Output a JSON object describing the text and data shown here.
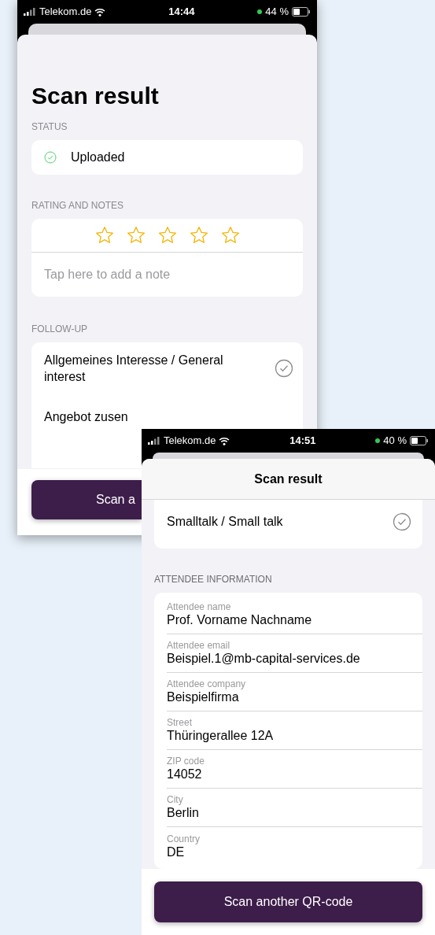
{
  "screen_1": {
    "status_bar": {
      "carrier": "Telekom.de",
      "time": "14:44",
      "battery": "44 %"
    },
    "title": "Scan result",
    "status": {
      "heading": "STATUS",
      "text": "Uploaded"
    },
    "rating": {
      "heading": "RATING AND NOTES",
      "stars": 0,
      "note_placeholder": "Tap here to add a note"
    },
    "follow_up": {
      "heading": "FOLLOW-UP",
      "items": [
        {
          "label": "Allgemeines Interesse / General interest",
          "checked": true
        },
        {
          "label": "Angebot zusen"
        }
      ]
    },
    "button": "Scan a"
  },
  "screen_2": {
    "status_bar": {
      "carrier": "Telekom.de",
      "time": "14:51",
      "battery": "40 %"
    },
    "title": "Scan result",
    "follow_up_items": [
      {
        "label": "Smalltalk / Small talk",
        "checked": true
      }
    ],
    "attendee": {
      "heading": "ATTENDEE INFORMATION",
      "fields": [
        {
          "label": "Attendee name",
          "value": "Prof. Vorname Nachname"
        },
        {
          "label": "Attendee email",
          "value": "Beispiel.1@mb-capital-services.de"
        },
        {
          "label": "Attendee company",
          "value": "Beispielfirma"
        },
        {
          "label": "Street",
          "value": "Thüringerallee 12A"
        },
        {
          "label": "ZIP code",
          "value": "14052"
        },
        {
          "label": "City",
          "value": "Berlin"
        },
        {
          "label": "Country",
          "value": "DE"
        }
      ]
    },
    "button": "Scan another QR-code"
  }
}
